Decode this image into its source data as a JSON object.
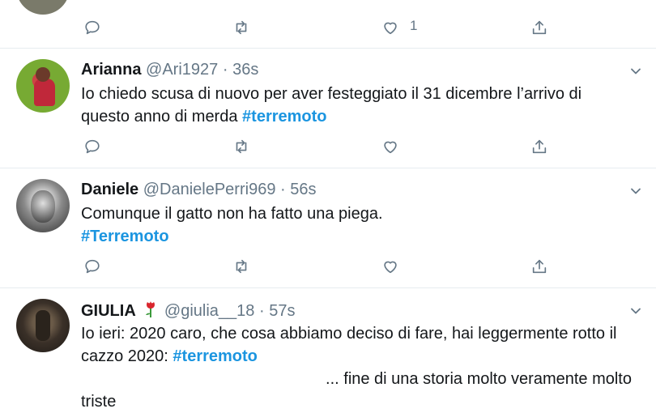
{
  "tweets": [
    {
      "name": "",
      "handle": "",
      "time": "",
      "text": "",
      "likes": "1"
    },
    {
      "name": "Arianna",
      "handle": "@Ari1927",
      "time": "36s",
      "text": "Io chiedo scusa di nuovo per aver festeggiato il 31 dicembre l’arrivo di questo anno di merda",
      "hashtag": "#terremoto"
    },
    {
      "name": "Daniele",
      "handle": "@DanielePerri969",
      "time": "56s",
      "text": "Comunque il gatto non ha fatto una piega.",
      "hashtag": "#Terremoto"
    },
    {
      "name": "GIULIA",
      "handle": "@giulia__18",
      "time": "57s",
      "text": "Io ieri: 2020 caro, che cosa abbiamo deciso di fare, hai leggermente rotto il cazzo 2020:",
      "hashtag": "#terremoto",
      "text2": "... fine di una storia molto veramente molto",
      "text3": "triste",
      "emoji": "rose-icon"
    }
  ],
  "separator": "·",
  "colors": {
    "hashtag": "#1b95e0",
    "secondary": "#657786",
    "divider": "#e6ecf0"
  }
}
